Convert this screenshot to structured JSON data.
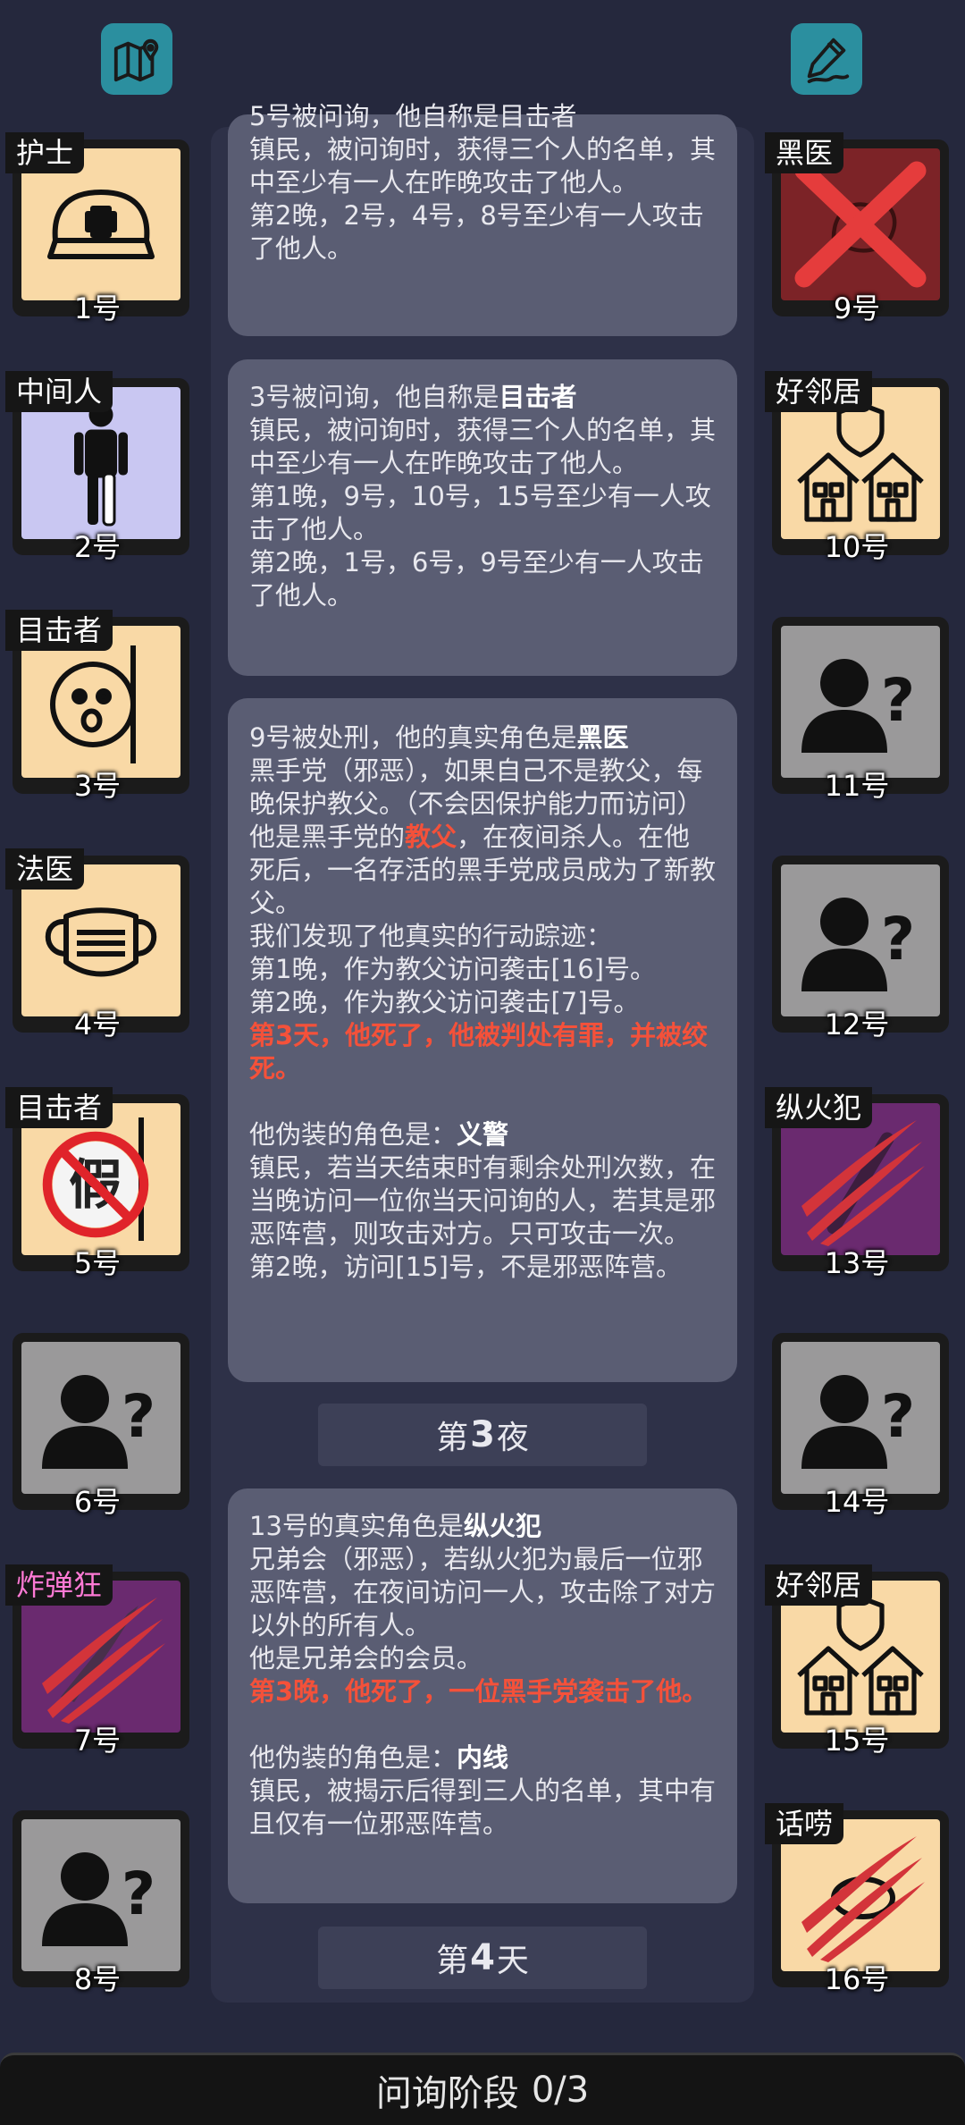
{
  "top_buttons": {
    "left_icon": "map-pin-icon",
    "right_icon": "pen-edit-icon"
  },
  "cards": [
    {
      "lines": [
        "5号被问询，他自称是目击者",
        "镇民，被问询时，获得三个人的名单，其中至少有一人在昨晚攻击了他人。",
        "第2晚，2号，4号，8号至少有一人攻击了他人。"
      ]
    },
    {
      "head_pre": "3号被问询，他自称是",
      "head_role": "目击者",
      "lines": [
        "镇民，被问询时，获得三个人的名单，其中至少有一人在昨晚攻击了他人。",
        "第1晚，9号，10号，15号至少有一人攻击了他人。",
        "第2晚，1号，6号，9号至少有一人攻击了他人。"
      ]
    },
    {
      "head_pre": "9号被处刑，他的真实角色是",
      "head_role": "黑医",
      "desc": "黑手党（邪恶），如果自己不是教父，每晚保护教父。（不会因保护能力而访问）",
      "godfather_pre": "他是黑手党的",
      "godfather_word": "教父",
      "godfather_post": "，在夜间杀人。在他死后，一名存活的黑手党成员成为了新教父。",
      "trace_title": "我们发现了他真实的行动踪迹：",
      "trace": [
        "第1晚，作为教父访问袭击[16]号。",
        "第2晚，作为教父访问袭击[7]号。"
      ],
      "death": "第3天，他死了，他被判处有罪，并被绞死。",
      "disguise_pre": "他伪装的角色是：",
      "disguise_role": "义警",
      "disguise_desc": "镇民，若当天结束时有剩余处刑次数，在当晚访问一位你当天问询的人，若其是邪恶阵营，则攻击对方。只可攻击一次。",
      "disguise_result": "第2晚，访问[15]号，不是邪恶阵营。"
    },
    {
      "head_pre": "13号的真实角色是",
      "head_role": "纵火犯",
      "desc": "兄弟会（邪恶），若纵火犯为最后一位邪恶阵营，在夜间访问一人，攻击除了对方以外的所有人。",
      "member": "他是兄弟会的会员。",
      "death": "第3晚，他死了，一位黑手党袭击了他。",
      "disguise_pre": "他伪装的角色是：",
      "disguise_role": "内线",
      "disguise_desc": "镇民，被揭示后得到三人的名单，其中有且仅有一位邪恶阵营。"
    }
  ],
  "dividers": [
    {
      "pre": "第",
      "num": "3",
      "post": "夜"
    },
    {
      "pre": "第",
      "num": "4",
      "post": "天"
    }
  ],
  "players_left": [
    {
      "role": "护士",
      "seat": "1号",
      "bg": "#f9d9a6",
      "icon": "nurse-cap-icon"
    },
    {
      "role": "中间人",
      "seat": "2号",
      "bg": "#c9c7f2",
      "icon": "person-figure-icon"
    },
    {
      "role": "目击者",
      "seat": "3号",
      "bg": "#f9d9a6",
      "icon": "peeking-face-icon"
    },
    {
      "role": "法医",
      "seat": "4号",
      "bg": "#f9d9a6",
      "icon": "face-mask-icon"
    },
    {
      "role": "目击者",
      "seat": "5号",
      "bg": "#f9d9a6",
      "icon": "fake-stamp-icon",
      "stamp_text": "假"
    },
    {
      "role": "",
      "seat": "6号",
      "bg": "#9a999a",
      "icon": "unknown-person-icon"
    },
    {
      "role": "炸弹狂",
      "seat": "7号",
      "bg": "#6a2a6f",
      "icon": "claw-slash-icon",
      "pink": true
    },
    {
      "role": "",
      "seat": "8号",
      "bg": "#9a999a",
      "icon": "unknown-person-icon"
    }
  ],
  "players_right": [
    {
      "role": "黑医",
      "seat": "9号",
      "bg": "#7c2327",
      "icon": "crossed-out-icon"
    },
    {
      "role": "好邻居",
      "seat": "10号",
      "bg": "#f9d9a6",
      "icon": "houses-shield-icon"
    },
    {
      "role": "",
      "seat": "11号",
      "bg": "#9a999a",
      "icon": "unknown-person-icon"
    },
    {
      "role": "",
      "seat": "12号",
      "bg": "#9a999a",
      "icon": "unknown-person-icon"
    },
    {
      "role": "纵火犯",
      "seat": "13号",
      "bg": "#6a2a6f",
      "icon": "claw-slash-icon"
    },
    {
      "role": "",
      "seat": "14号",
      "bg": "#9a999a",
      "icon": "unknown-person-icon"
    },
    {
      "role": "好邻居",
      "seat": "15号",
      "bg": "#f9d9a6",
      "icon": "houses-shield-icon"
    },
    {
      "role": "话唠",
      "seat": "16号",
      "bg": "#f9d9a6",
      "icon": "claw-slash-icon"
    }
  ],
  "phase": {
    "label": "问询阶段",
    "progress": "0/3"
  }
}
